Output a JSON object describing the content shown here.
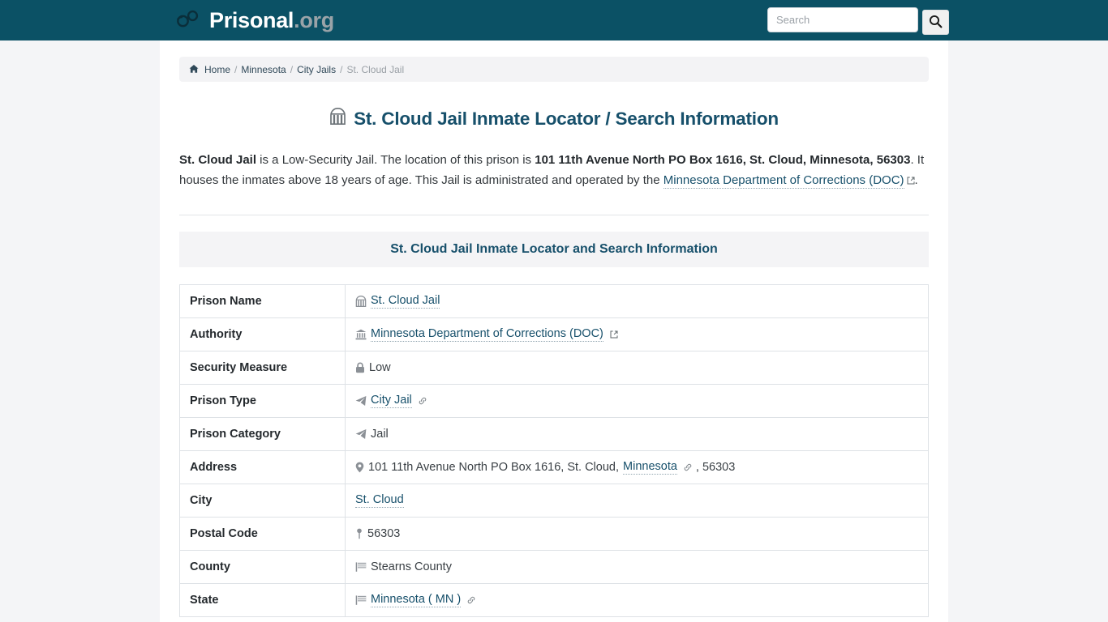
{
  "header": {
    "brand_main": "Prisonal",
    "brand_tld": ".org",
    "logo_icon": "handcuffs-icon",
    "search": {
      "placeholder": "Search",
      "value": "",
      "button_icon": "search-icon"
    }
  },
  "breadcrumb": {
    "home_icon": "home-icon",
    "items": [
      {
        "label": "Home",
        "link": true
      },
      {
        "label": "Minnesota",
        "link": true
      },
      {
        "label": "City Jails",
        "link": true
      },
      {
        "label": "St. Cloud Jail",
        "link": false
      }
    ],
    "separator": "/"
  },
  "main": {
    "title_icon": "jail-door-icon",
    "title": "St. Cloud Jail Inmate Locator / Search Information",
    "intro": {
      "prison_name": "St. Cloud Jail",
      "text_1": " is a Low-Security Jail. The location of this prison is ",
      "address_bold": "101 11th Avenue North PO Box 1616, St. Cloud, Minnesota, 56303",
      "text_2": ". It houses the inmates above 18 years of age. This Jail is administrated and operated by the ",
      "authority_link": "Minnesota Department of Corrections (DOC)",
      "text_3": "."
    },
    "table": {
      "caption": "St. Cloud Jail Inmate Locator and Search Information",
      "rows": [
        {
          "key": "Prison Name",
          "value": "St. Cloud Jail",
          "icon": "jail-door-icon",
          "link": true,
          "trailing_icon": ""
        },
        {
          "key": "Authority",
          "value": "Minnesota Department of Corrections (DOC)",
          "icon": "bank-icon",
          "link": true,
          "trailing_icon": "external-link-icon"
        },
        {
          "key": "Security Measure",
          "value": "Low",
          "icon": "lock-icon",
          "link": false,
          "trailing_icon": ""
        },
        {
          "key": "Prison Type",
          "value": "City Jail",
          "icon": "paper-plane-icon",
          "link": true,
          "trailing_icon": "link-icon"
        },
        {
          "key": "Prison Category",
          "value": "Jail",
          "icon": "paper-plane-icon",
          "link": false,
          "trailing_icon": ""
        },
        {
          "key": "Address",
          "value": "101 11th Avenue North PO Box 1616, St. Cloud, ",
          "value_link": "Minnesota",
          "value_tail": ", 56303",
          "icon": "map-marker-icon",
          "link": false,
          "trailing_icon": "link-icon"
        },
        {
          "key": "City",
          "value": "St. Cloud",
          "icon": "",
          "link": true,
          "trailing_icon": ""
        },
        {
          "key": "Postal Code",
          "value": "56303",
          "icon": "map-pin-icon",
          "link": false,
          "trailing_icon": ""
        },
        {
          "key": "County",
          "value": "Stearns County",
          "icon": "flag-icon",
          "link": false,
          "trailing_icon": ""
        },
        {
          "key": "State",
          "value": "Minnesota ( MN )",
          "icon": "flag-icon",
          "link": true,
          "trailing_icon": "link-icon"
        }
      ]
    }
  },
  "colors": {
    "header_bg": "#0b5165",
    "accent": "#17506b",
    "page_bg": "#f4f5f7",
    "content_bg": "#ffffff",
    "caption_bg": "#f4f4f6",
    "border": "#dee2e6"
  }
}
